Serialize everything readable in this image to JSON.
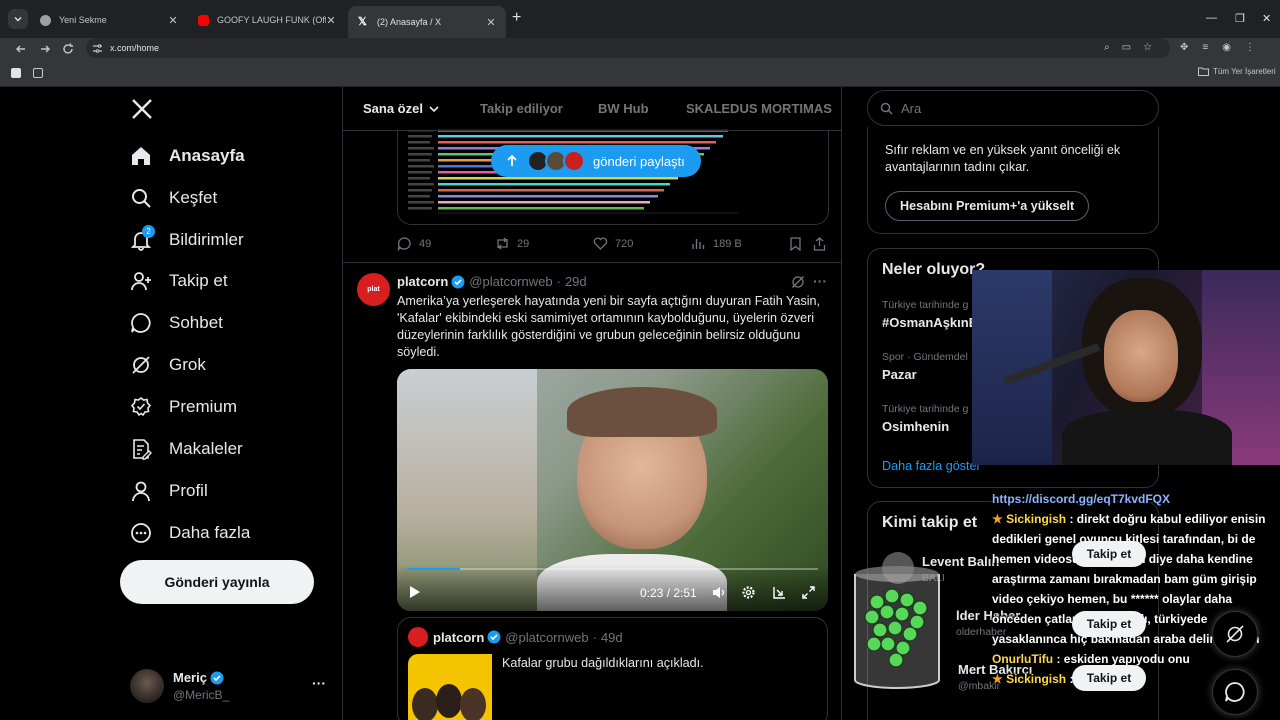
{
  "browser": {
    "tabs": [
      {
        "title": "Yeni Sekme",
        "active": false
      },
      {
        "title": "GOOFY LAUGH FUNK (Official A",
        "active": false
      },
      {
        "title": "(2) Anasayfa / X",
        "active": true
      }
    ],
    "url": "x.com/home",
    "bookmarks_label": "Tüm Yer İşaretleri"
  },
  "sidebar": {
    "items": [
      {
        "label": "Anasayfa",
        "icon": "home-icon"
      },
      {
        "label": "Keşfet",
        "icon": "search-icon"
      },
      {
        "label": "Bildirimler",
        "icon": "bell-icon",
        "badge": "2"
      },
      {
        "label": "Takip et",
        "icon": "follow-icon"
      },
      {
        "label": "Sohbet",
        "icon": "chat-icon"
      },
      {
        "label": "Grok",
        "icon": "grok-icon"
      },
      {
        "label": "Premium",
        "icon": "premium-icon"
      },
      {
        "label": "Makaleler",
        "icon": "articles-icon"
      },
      {
        "label": "Profil",
        "icon": "profile-icon"
      },
      {
        "label": "Daha fazla",
        "icon": "more-icon"
      }
    ],
    "post_button": "Gönderi yayınla",
    "account": {
      "name": "Meriç",
      "handle": "@MericB_"
    }
  },
  "feed": {
    "tabs": [
      "Sana özel",
      "Takip ediliyor",
      "BW Hub",
      "SKALEDUS MORTIMAS"
    ],
    "share_pill": "gönderi paylaştı",
    "prev_actions": {
      "replies": "49",
      "reposts": "29",
      "likes": "720",
      "views": "189 B"
    },
    "tweet": {
      "name": "platcorn",
      "handle": "@platcornweb",
      "time": "29d",
      "text": "Amerika’ya yerleşerek hayatında yeni bir sayfa açtığını duyuran Fatih Yasin, 'Kafalar' ekibindeki eski samimiyet ortamının kaybolduğunu, üyelerin özveri düzeylerinin farklılık gösterdiğini ve grubun geleceğinin belirsiz olduğunu söyledi.",
      "video_time": "0:23 / 2:51",
      "video_progress": 0.13,
      "quote": {
        "name": "platcorn",
        "handle": "@platcornweb",
        "time": "49d",
        "text": "Kafalar grubu dağıldıklarını açıkladı."
      }
    }
  },
  "right": {
    "search_placeholder": "Ara",
    "premium_text": "Sıfır reklam ve en yüksek yanıt önceliği ek avantajlarının tadını çıkar.",
    "premium_button": "Hesabını Premium+'a yükselt",
    "trends_title": "Neler oluyor?",
    "trends": [
      {
        "context": "Türkiye tarihinde g",
        "name": "#OsmanAşkınB"
      },
      {
        "context": "Spor · Gündemdel",
        "name": "Pazar"
      },
      {
        "context": "Türkiye tarihinde g",
        "name": "Osimhenin"
      }
    ],
    "show_more": "Daha fazla göster",
    "who_to_follow_title": "Kimi takip et",
    "follow_suggestions": [
      {
        "name": "Levent Balın",
        "handle": "BALI",
        "button": "Takip et"
      },
      {
        "name": "lder Haber",
        "handle": "olderhaber",
        "button": "Takip et"
      },
      {
        "name": "Mert Bakırcı",
        "handle": "@mbakir",
        "button": "Takip et"
      }
    ]
  },
  "chat_overlay": {
    "link": "https://discord.gg/eqT7kvdFQX",
    "messages": [
      {
        "user": "Sickingish",
        "text": ": direkt doğru kabul ediliyor enisin dedikleri genel oyuncu kitlesi tarafından, bi de hemen videosunu yapıcam diye daha kendine araştırma zamanı bırakmadan bam güm girişip video çekiyo hemen, bu ****** olaylar daha önceden çatlamaya başladı, türkiyede yasaklanınca hiç bakmadan araba delirdi adam"
      },
      {
        "user": "OnurluTifu",
        "text": ": eskiden yapıyodu onu"
      },
      {
        "user": "Sickingish",
        "text": ":"
      }
    ]
  },
  "colors": {
    "accent": "#1d9bf0",
    "background": "#000000",
    "muted": "#71767b"
  }
}
